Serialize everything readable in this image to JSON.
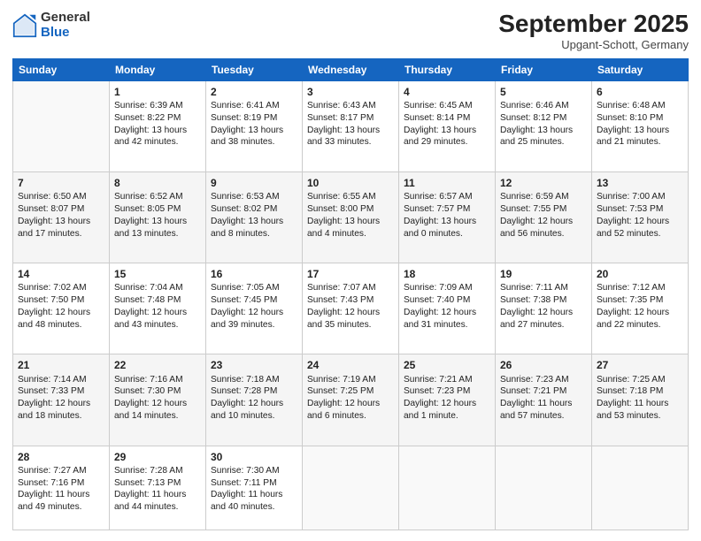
{
  "header": {
    "logo_general": "General",
    "logo_blue": "Blue",
    "month_title": "September 2025",
    "subtitle": "Upgant-Schott, Germany"
  },
  "days_of_week": [
    "Sunday",
    "Monday",
    "Tuesday",
    "Wednesday",
    "Thursday",
    "Friday",
    "Saturday"
  ],
  "weeks": [
    [
      {
        "day": "",
        "content": ""
      },
      {
        "day": "1",
        "content": "Sunrise: 6:39 AM\nSunset: 8:22 PM\nDaylight: 13 hours\nand 42 minutes."
      },
      {
        "day": "2",
        "content": "Sunrise: 6:41 AM\nSunset: 8:19 PM\nDaylight: 13 hours\nand 38 minutes."
      },
      {
        "day": "3",
        "content": "Sunrise: 6:43 AM\nSunset: 8:17 PM\nDaylight: 13 hours\nand 33 minutes."
      },
      {
        "day": "4",
        "content": "Sunrise: 6:45 AM\nSunset: 8:14 PM\nDaylight: 13 hours\nand 29 minutes."
      },
      {
        "day": "5",
        "content": "Sunrise: 6:46 AM\nSunset: 8:12 PM\nDaylight: 13 hours\nand 25 minutes."
      },
      {
        "day": "6",
        "content": "Sunrise: 6:48 AM\nSunset: 8:10 PM\nDaylight: 13 hours\nand 21 minutes."
      }
    ],
    [
      {
        "day": "7",
        "content": "Sunrise: 6:50 AM\nSunset: 8:07 PM\nDaylight: 13 hours\nand 17 minutes."
      },
      {
        "day": "8",
        "content": "Sunrise: 6:52 AM\nSunset: 8:05 PM\nDaylight: 13 hours\nand 13 minutes."
      },
      {
        "day": "9",
        "content": "Sunrise: 6:53 AM\nSunset: 8:02 PM\nDaylight: 13 hours\nand 8 minutes."
      },
      {
        "day": "10",
        "content": "Sunrise: 6:55 AM\nSunset: 8:00 PM\nDaylight: 13 hours\nand 4 minutes."
      },
      {
        "day": "11",
        "content": "Sunrise: 6:57 AM\nSunset: 7:57 PM\nDaylight: 13 hours\nand 0 minutes."
      },
      {
        "day": "12",
        "content": "Sunrise: 6:59 AM\nSunset: 7:55 PM\nDaylight: 12 hours\nand 56 minutes."
      },
      {
        "day": "13",
        "content": "Sunrise: 7:00 AM\nSunset: 7:53 PM\nDaylight: 12 hours\nand 52 minutes."
      }
    ],
    [
      {
        "day": "14",
        "content": "Sunrise: 7:02 AM\nSunset: 7:50 PM\nDaylight: 12 hours\nand 48 minutes."
      },
      {
        "day": "15",
        "content": "Sunrise: 7:04 AM\nSunset: 7:48 PM\nDaylight: 12 hours\nand 43 minutes."
      },
      {
        "day": "16",
        "content": "Sunrise: 7:05 AM\nSunset: 7:45 PM\nDaylight: 12 hours\nand 39 minutes."
      },
      {
        "day": "17",
        "content": "Sunrise: 7:07 AM\nSunset: 7:43 PM\nDaylight: 12 hours\nand 35 minutes."
      },
      {
        "day": "18",
        "content": "Sunrise: 7:09 AM\nSunset: 7:40 PM\nDaylight: 12 hours\nand 31 minutes."
      },
      {
        "day": "19",
        "content": "Sunrise: 7:11 AM\nSunset: 7:38 PM\nDaylight: 12 hours\nand 27 minutes."
      },
      {
        "day": "20",
        "content": "Sunrise: 7:12 AM\nSunset: 7:35 PM\nDaylight: 12 hours\nand 22 minutes."
      }
    ],
    [
      {
        "day": "21",
        "content": "Sunrise: 7:14 AM\nSunset: 7:33 PM\nDaylight: 12 hours\nand 18 minutes."
      },
      {
        "day": "22",
        "content": "Sunrise: 7:16 AM\nSunset: 7:30 PM\nDaylight: 12 hours\nand 14 minutes."
      },
      {
        "day": "23",
        "content": "Sunrise: 7:18 AM\nSunset: 7:28 PM\nDaylight: 12 hours\nand 10 minutes."
      },
      {
        "day": "24",
        "content": "Sunrise: 7:19 AM\nSunset: 7:25 PM\nDaylight: 12 hours\nand 6 minutes."
      },
      {
        "day": "25",
        "content": "Sunrise: 7:21 AM\nSunset: 7:23 PM\nDaylight: 12 hours\nand 1 minute."
      },
      {
        "day": "26",
        "content": "Sunrise: 7:23 AM\nSunset: 7:21 PM\nDaylight: 11 hours\nand 57 minutes."
      },
      {
        "day": "27",
        "content": "Sunrise: 7:25 AM\nSunset: 7:18 PM\nDaylight: 11 hours\nand 53 minutes."
      }
    ],
    [
      {
        "day": "28",
        "content": "Sunrise: 7:27 AM\nSunset: 7:16 PM\nDaylight: 11 hours\nand 49 minutes."
      },
      {
        "day": "29",
        "content": "Sunrise: 7:28 AM\nSunset: 7:13 PM\nDaylight: 11 hours\nand 44 minutes."
      },
      {
        "day": "30",
        "content": "Sunrise: 7:30 AM\nSunset: 7:11 PM\nDaylight: 11 hours\nand 40 minutes."
      },
      {
        "day": "",
        "content": ""
      },
      {
        "day": "",
        "content": ""
      },
      {
        "day": "",
        "content": ""
      },
      {
        "day": "",
        "content": ""
      }
    ]
  ]
}
